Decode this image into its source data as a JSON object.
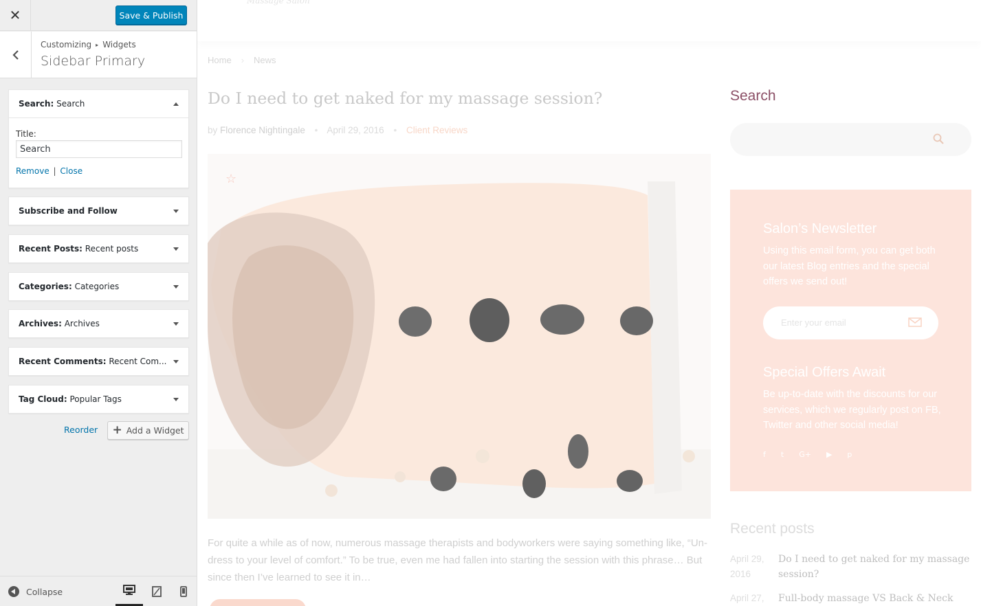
{
  "customizer": {
    "close_icon": "close-icon",
    "publish_label": "Save & Publish",
    "breadcrumb": [
      "Customizing",
      "Widgets"
    ],
    "section_title": "Sidebar Primary",
    "widgets": [
      {
        "type": "Search",
        "title": "Search",
        "expanded": true
      },
      {
        "type": "Subscribe and Follow",
        "title": ""
      },
      {
        "type": "Recent Posts",
        "title": "Recent posts"
      },
      {
        "type": "Categories",
        "title": "Categories"
      },
      {
        "type": "Archives",
        "title": "Archives"
      },
      {
        "type": "Recent Comments",
        "title": "Recent Com..."
      },
      {
        "type": "Tag Cloud",
        "title": "Popular Tags"
      }
    ],
    "search_widget_form": {
      "title_label": "Title:",
      "title_value": "Search",
      "remove_label": "Remove",
      "separator": "|",
      "close_label": "Close"
    },
    "reorder_label": "Reorder",
    "add_widget_label": "Add a Widget",
    "collapse_label": "Collapse",
    "devices": [
      "desktop",
      "tablet",
      "mobile"
    ],
    "active_device": "desktop",
    "accent_color": "#0085ba"
  },
  "preview": {
    "logo_text": "Massage Salon",
    "breadcrumb": [
      "Home",
      "News"
    ],
    "post": {
      "title": "Do I need to get naked for my massage session?",
      "by": "by",
      "author": "Florence Nightingale",
      "date": "April 29, 2016",
      "category": "Client Reviews",
      "excerpt": "For quite a while as of now, numerous massage therapists and bodyworkers were saying something like, “Un-dress to your level of comfort.” To be true, even me had fallen into starting the session with this phrase… But since then I’ve learned to see it in…"
    },
    "sidebar": {
      "search_title": "Search",
      "newsletter_title": "Salon’s Newsletter",
      "newsletter_text": "Using this email form, you can get both our latest Blog entries and the special offers we send out!",
      "email_placeholder": "Enter your email",
      "offers_title": "Special Offers Await",
      "offers_text": "Be up-to-date with the discounts for our services, which we regularly post on FB, Twitter and other social media!",
      "social": [
        {
          "icon": "facebook-icon",
          "glyph": "f"
        },
        {
          "icon": "twitter-icon",
          "glyph": "t"
        },
        {
          "icon": "google-plus-icon",
          "glyph": "G+"
        },
        {
          "icon": "youtube-icon",
          "glyph": "▶"
        },
        {
          "icon": "pinterest-icon",
          "glyph": "p"
        }
      ],
      "recent_title": "Recent posts",
      "recent_posts": [
        {
          "date": "April 29, 2016",
          "title": "Do I need to get naked for my massage session?"
        },
        {
          "date": "April 27,",
          "title": "Full-body massage VS Back & Neck mas-"
        }
      ]
    },
    "newsletter_color": "#fde4dc"
  }
}
